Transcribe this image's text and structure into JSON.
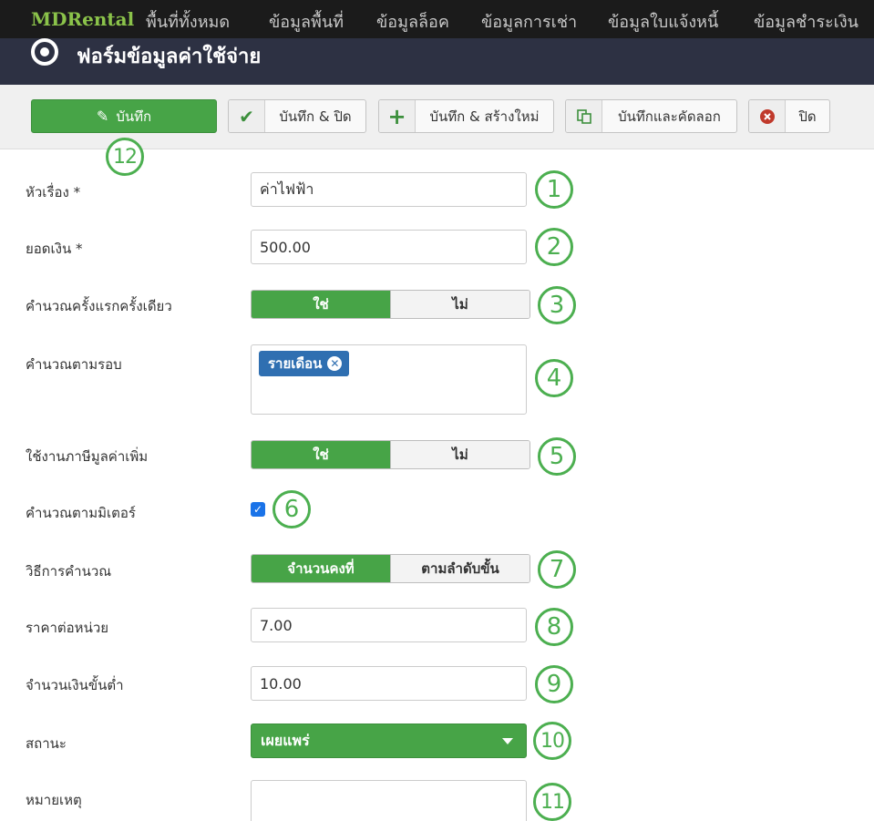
{
  "nav": {
    "brand": "MDRental",
    "items": [
      "พื้นที่ทั้งหมด",
      "ข้อมูลพื้นที่",
      "ข้อมูลล็อค",
      "ข้อมูลการเช่า",
      "ข้อมูลใบแจ้งหนี้",
      "ข้อมูลชำระเงิน"
    ]
  },
  "header": {
    "title": "ฟอร์มข้อมูลค่าใช้จ่าย"
  },
  "toolbar": {
    "save": "บันทึก",
    "save_close": "บันทึก & ปิด",
    "save_new": "บันทึก & สร้างใหม่",
    "save_copy": "บันทึกและคัดลอก",
    "close": "ปิด"
  },
  "form": {
    "title_label": "หัวเรื่อง *",
    "title_value": "ค่าไฟฟ้า",
    "amount_label": "ยอดเงิน *",
    "amount_value": "500.00",
    "first_time_label": "คำนวณครั้งแรกครั้งเดียว",
    "period_label": "คำนวณตามรอบ",
    "period_tag": "รายเดือน",
    "vat_label": "ใช้งานภาษีมูลค่าเพิ่ม",
    "meter_label": "คำนวณตามมิเตอร์",
    "meter_checked": true,
    "method_label": "วิธีการคำนวณ",
    "method_fixed": "จำนวนคงที่",
    "method_tiered": "ตามลำดับขั้น",
    "unit_price_label": "ราคาต่อหน่วย",
    "unit_price_value": "7.00",
    "minimum_label": "จำนวนเงินขั้นต่ำ",
    "minimum_value": "10.00",
    "status_label": "สถานะ",
    "status_value": "เผยแพร่",
    "note_label": "หมายเหตุ",
    "yes": "ใช่",
    "no": "ไม่"
  },
  "annotations": [
    "1",
    "2",
    "3",
    "4",
    "5",
    "6",
    "7",
    "8",
    "9",
    "10",
    "11",
    "12"
  ],
  "colors": {
    "green": "#47a447",
    "annotation": "#4caf50",
    "tag_blue": "#2f6fb1",
    "titlebar": "#2d3143",
    "nav": "#1b1b1b"
  }
}
